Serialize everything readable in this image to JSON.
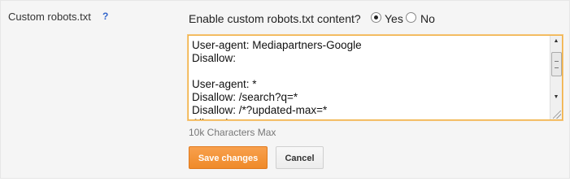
{
  "setting": {
    "label": "Custom robots.txt",
    "help": "?"
  },
  "enable": {
    "question": "Enable custom robots.txt content?",
    "options": [
      {
        "label": "Yes",
        "checked": true
      },
      {
        "label": "No",
        "checked": false
      }
    ]
  },
  "editor": {
    "content": "User-agent: Mediapartners-Google\nDisallow:\n\nUser-agent: *\nDisallow: /search?q=*\nDisallow: /*?updated-max=*\nAllow: /",
    "limit_note": "10k Characters Max"
  },
  "actions": {
    "save_label": "Save changes",
    "cancel_label": "Cancel"
  },
  "colors": {
    "accent": "#ef8a29",
    "focus_border": "#f0b044",
    "help_link": "#3366cc"
  }
}
